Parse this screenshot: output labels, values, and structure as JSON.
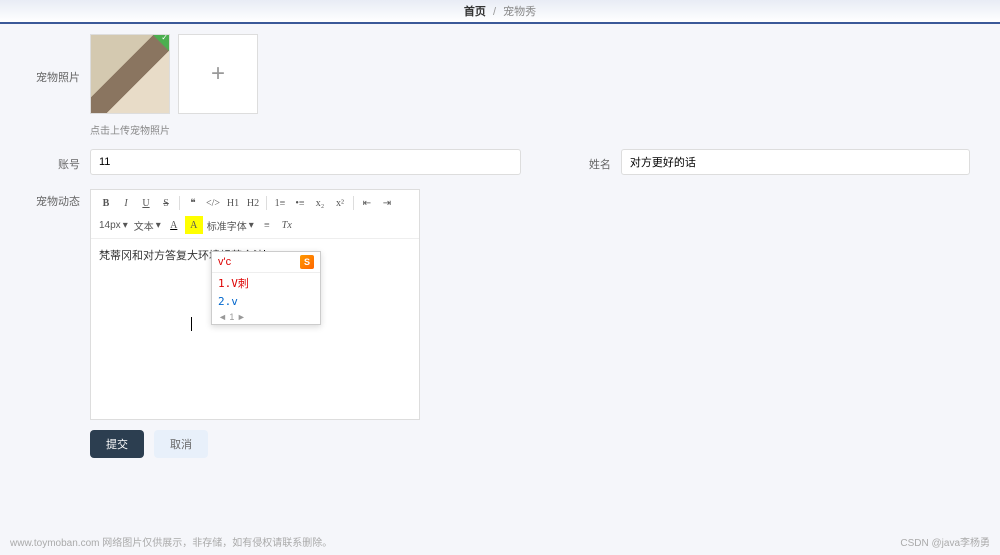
{
  "breadcrumb": {
    "home": "首页",
    "current": "宠物秀"
  },
  "labels": {
    "photo": "宠物照片",
    "account": "账号",
    "name": "姓名",
    "diary": "宠物动态"
  },
  "hint": "点击上传宠物照片",
  "fields": {
    "account": "11",
    "name": "对方更好的话"
  },
  "editor": {
    "toolbar": {
      "bold": "B",
      "italic": "I",
      "underline": "U",
      "strike": "S",
      "h1": "H1",
      "h2": "H2",
      "quote": "❝",
      "code": "</>",
      "ol": "1≡",
      "ul": "•≡",
      "sub": "x₂",
      "sup": "x²",
      "outdent": "⇤",
      "indent": "⇥",
      "fontsize": "14px",
      "font": "文本",
      "color": "A",
      "bg": "A",
      "fontfamily": "标准字体",
      "align": "≡",
      "clear": "Tx",
      "caret": "▾"
    },
    "content": "梵蒂冈和对方答复大环境规范合法"
  },
  "ime": {
    "input": "v'c",
    "logo": "S",
    "candidates": [
      {
        "idx": "1.",
        "text": "V刺",
        "cls": "red"
      },
      {
        "idx": "2.",
        "text": "v",
        "cls": "blue"
      }
    ],
    "pager": "◄ 1 ►"
  },
  "buttons": {
    "submit": "提交",
    "cancel": "取消"
  },
  "footer": {
    "left": "www.toymoban.com  网络图片仅供展示，非存储，如有侵权请联系删除。",
    "right": "CSDN @java李杨勇"
  }
}
